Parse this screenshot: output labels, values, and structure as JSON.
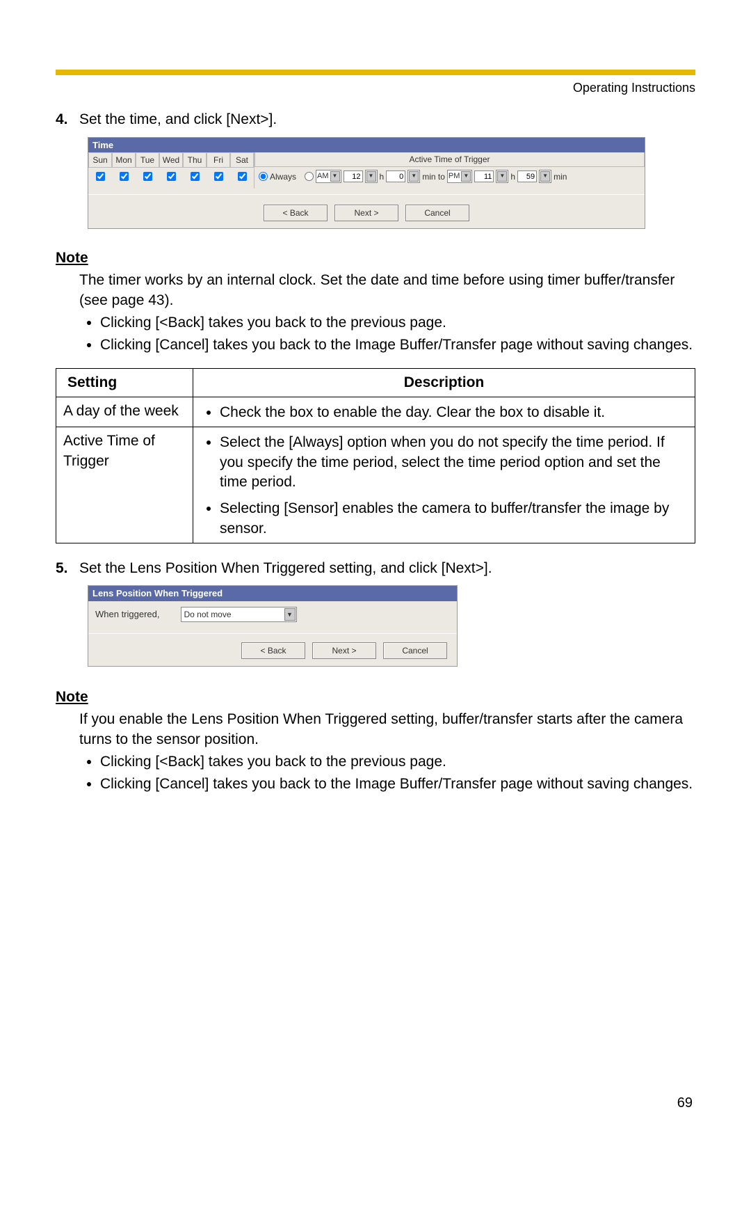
{
  "header": {
    "right": "Operating Instructions"
  },
  "step4": {
    "num": "4.",
    "text": "Set the time, and click [Next>]."
  },
  "timePanel": {
    "title": "Time",
    "days": [
      "Sun",
      "Mon",
      "Tue",
      "Wed",
      "Thu",
      "Fri",
      "Sat"
    ],
    "activeHead": "Active Time of Trigger",
    "alwaysLabel": "Always",
    "fromAMPM": "AM",
    "fromH": "12",
    "hLabel": "h",
    "fromM": "0",
    "minToLabel": "min to",
    "toAMPM": "PM",
    "toH": "11",
    "toM": "59",
    "minLabel": "min",
    "back": "< Back",
    "next": "Next >",
    "cancel": "Cancel"
  },
  "note1": {
    "heading": "Note",
    "para": "The timer works by an internal clock. Set the date and time before using timer buffer/transfer (see page 43).",
    "b1": "Clicking [<Back] takes you back to the previous page.",
    "b2": "Clicking [Cancel] takes you back to the Image Buffer/Transfer page without saving changes."
  },
  "table": {
    "h1": "Setting",
    "h2": "Description",
    "r1s": "A day of the week",
    "r1d1": "Check the box to enable the day. Clear the box to disable it.",
    "r2s": "Active Time of Trigger",
    "r2d1": "Select the [Always] option when you do not specify the time period. If you specify the time period, select the time period option and set the time period.",
    "r2d2": "Selecting [Sensor] enables the camera to buffer/transfer the image by sensor."
  },
  "step5": {
    "num": "5.",
    "text": "Set the Lens Position When Triggered setting, and click [Next>]."
  },
  "lensPanel": {
    "title": "Lens Position When Triggered",
    "label": "When triggered,",
    "value": "Do not move",
    "back": "< Back",
    "next": "Next >",
    "cancel": "Cancel"
  },
  "note2": {
    "heading": "Note",
    "para": "If you enable the Lens Position When Triggered setting, buffer/transfer starts after the camera turns to the sensor position.",
    "b1": "Clicking [<Back] takes you back to the previous page.",
    "b2": "Clicking [Cancel] takes you back to the Image Buffer/Transfer page without saving changes."
  },
  "pageNum": "69"
}
